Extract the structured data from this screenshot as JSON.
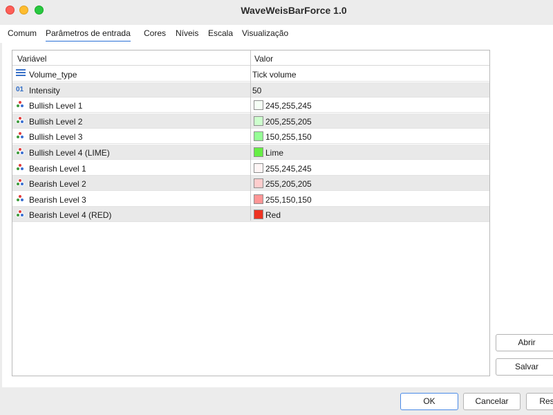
{
  "window": {
    "title": "WaveWeisBarForce 1.0"
  },
  "tabs": [
    {
      "label": "Comum",
      "active": false
    },
    {
      "label": "Parâmetros de entrada",
      "active": true
    },
    {
      "label": "Cores",
      "active": false
    },
    {
      "label": "Níveis",
      "active": false
    },
    {
      "label": "Escala",
      "active": false
    },
    {
      "label": "Visualização",
      "active": false
    }
  ],
  "grid": {
    "columns": [
      "Variável",
      "Valor"
    ],
    "rows": [
      {
        "icon": "enum-lines-icon",
        "name": "Volume_type",
        "value": "Tick volume"
      },
      {
        "icon": "integer-01-icon",
        "name": "Intensity",
        "value": "50"
      },
      {
        "icon": "color-palette-icon",
        "name": "Bullish Level 1",
        "value": "245,255,245",
        "swatch": "#f5fff5"
      },
      {
        "icon": "color-palette-icon",
        "name": "Bullish Level 2",
        "value": "205,255,205",
        "swatch": "#cdffcd"
      },
      {
        "icon": "color-palette-icon",
        "name": "Bullish Level 3",
        "value": "150,255,150",
        "swatch": "#96ff96"
      },
      {
        "icon": "color-palette-icon",
        "name": "Bullish Level 4 (LIME)",
        "value": "Lime",
        "swatch": "#66ee44"
      },
      {
        "icon": "color-palette-icon",
        "name": "Bearish Level 1",
        "value": "255,245,245",
        "swatch": "#fff5f5"
      },
      {
        "icon": "color-palette-icon",
        "name": "Bearish Level 2",
        "value": "255,205,205",
        "swatch": "#ffcdcd"
      },
      {
        "icon": "color-palette-icon",
        "name": "Bearish Level 3",
        "value": "255,150,150",
        "swatch": "#ff9696"
      },
      {
        "icon": "color-palette-icon",
        "name": "Bearish Level 4 (RED)",
        "value": "Red",
        "swatch": "#ee3322"
      }
    ]
  },
  "side_buttons": {
    "open": "Abrir",
    "save": "Salvar"
  },
  "footer": {
    "ok": "OK",
    "cancel": "Cancelar",
    "reset": "Res"
  },
  "colors": {
    "accent": "#2a6fd6"
  }
}
